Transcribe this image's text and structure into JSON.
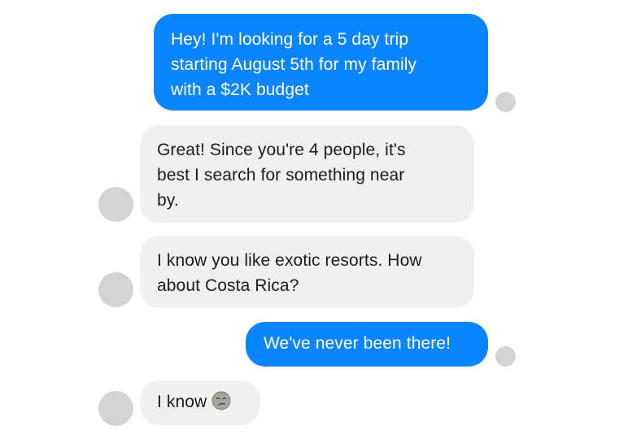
{
  "conversation": {
    "messages": [
      {
        "sender": "user",
        "text": "Hey! I'm looking for a 5 day trip\nstarting August 5th for my family\nwith a $2K budget"
      },
      {
        "sender": "bot",
        "text": "Great! Since you're 4 people, it's\nbest I search for something near\nby."
      },
      {
        "sender": "bot",
        "text": "I know you like exotic resorts. How\nabout Costa Rica?"
      },
      {
        "sender": "user",
        "text": "We've never been there!"
      },
      {
        "sender": "bot",
        "text": "I know",
        "emoji": "smirk-face-emoji"
      }
    ]
  },
  "colors": {
    "outgoing_bubble": "#0a84ff",
    "incoming_bubble": "#f1f0f0",
    "avatar_placeholder": "#d4d4d4"
  }
}
